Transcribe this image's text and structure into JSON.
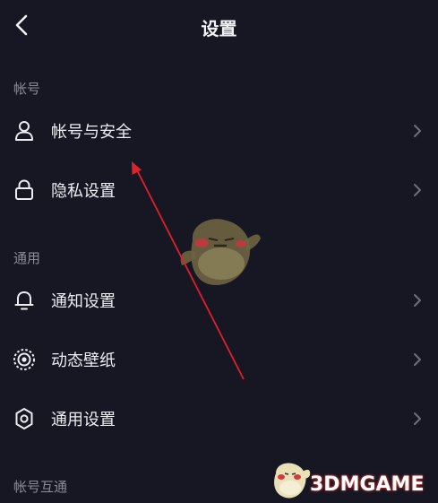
{
  "header": {
    "title": "设置",
    "back_icon": "chevron-left-icon"
  },
  "sections": {
    "account": {
      "title": "帐号",
      "items": [
        {
          "label": "帐号与安全",
          "icon": "user-icon"
        },
        {
          "label": "隐私设置",
          "icon": "lock-icon"
        }
      ]
    },
    "general": {
      "title": "通用",
      "items": [
        {
          "label": "通知设置",
          "icon": "bell-icon"
        },
        {
          "label": "动态壁纸",
          "icon": "live-wallpaper-icon"
        },
        {
          "label": "通用设置",
          "icon": "gear-icon"
        }
      ]
    },
    "interop": {
      "title": "帐号互通"
    }
  },
  "watermark": {
    "text": "3DMGAME",
    "logo": "mascot-logo"
  },
  "annotation": {
    "arrow_color": "#e0202a"
  },
  "colors": {
    "background": "#161723",
    "text": "#ececf1",
    "section_text": "#8b8c96",
    "chevron": "#6e6f79"
  }
}
